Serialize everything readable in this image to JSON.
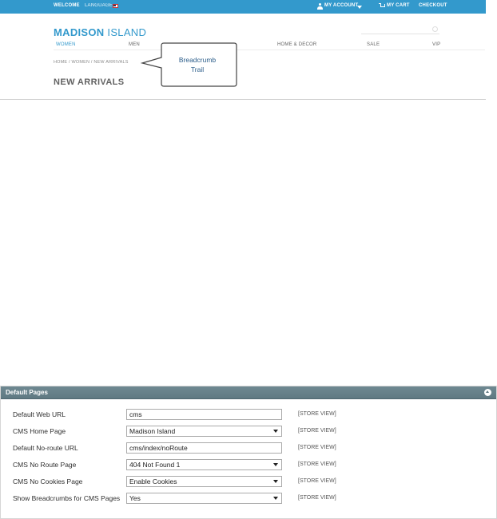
{
  "store": {
    "topbar": {
      "welcome": "WELCOME",
      "language": "LANGUAGE",
      "my_account": "MY ACCOUNT",
      "my_cart": "MY CART",
      "checkout": "CHECKOUT"
    },
    "logo": {
      "bold": "MADISON",
      "light": " ISLAND"
    },
    "nav": [
      "WOMEN",
      "MEN",
      "HOME & DECOR",
      "SALE",
      "VIP"
    ],
    "breadcrumb": "HOME / WOMEN / NEW ARRIVALS",
    "page_title": "NEW ARRIVALS",
    "callout": {
      "line1": "Breadcrumb",
      "line2": "Trail"
    }
  },
  "panel": {
    "title": "Default Pages",
    "rows": [
      {
        "label": "Default Web URL",
        "value": "cms",
        "type": "input",
        "scope": "[STORE VIEW]"
      },
      {
        "label": "CMS Home Page",
        "value": "Madison Island",
        "type": "select",
        "scope": "[STORE VIEW]"
      },
      {
        "label": "Default No-route URL",
        "value": "cms/index/noRoute",
        "type": "input",
        "scope": "[STORE VIEW]"
      },
      {
        "label": "CMS No Route Page",
        "value": "404 Not Found 1",
        "type": "select",
        "scope": "[STORE VIEW]"
      },
      {
        "label": "CMS No Cookies Page",
        "value": "Enable Cookies",
        "type": "select",
        "scope": "[STORE VIEW]"
      },
      {
        "label": "Show Breadcrumbs for CMS Pages",
        "value": "Yes",
        "type": "select",
        "scope": "[STORE VIEW]"
      }
    ]
  },
  "colors": {
    "brand": "#3399cc",
    "panel_header": "#5f7982",
    "callout_text": "#2b5d8a"
  }
}
